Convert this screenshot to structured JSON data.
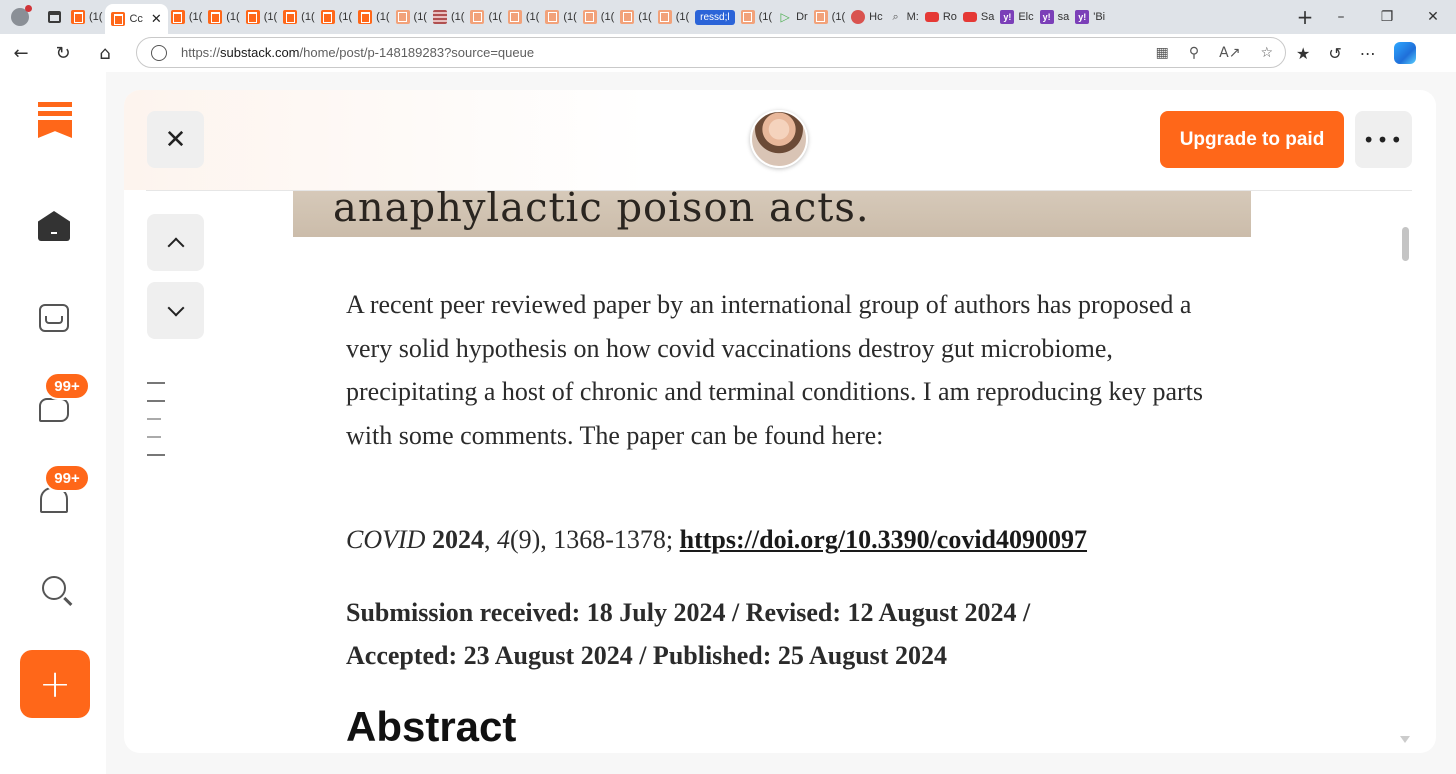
{
  "browser": {
    "tabs": [
      {
        "favicon": "substack",
        "label": "(1("
      },
      {
        "favicon": "substack",
        "label": "Cc",
        "active": true
      },
      {
        "favicon": "substack",
        "label": "(1("
      },
      {
        "favicon": "substack",
        "label": "(1("
      },
      {
        "favicon": "substack",
        "label": "(1("
      },
      {
        "favicon": "substack",
        "label": "(1("
      },
      {
        "favicon": "substack",
        "label": "(1("
      },
      {
        "favicon": "substack",
        "label": "(1("
      },
      {
        "favicon": "substack-faded",
        "label": "(1("
      },
      {
        "favicon": "stripes",
        "label": "(1("
      },
      {
        "favicon": "substack-faded",
        "label": "(1("
      },
      {
        "favicon": "substack-faded",
        "label": "(1("
      },
      {
        "favicon": "substack-faded",
        "label": "(1("
      },
      {
        "favicon": "substack-faded",
        "label": "(1("
      },
      {
        "favicon": "substack-faded",
        "label": "(1("
      },
      {
        "favicon": "substack-faded",
        "label": "(1("
      },
      {
        "favicon": "pill",
        "label": "ressd;l"
      },
      {
        "favicon": "substack-faded",
        "label": "(1("
      },
      {
        "favicon": "play",
        "label": "Dr"
      },
      {
        "favicon": "substack-faded",
        "label": "(1("
      },
      {
        "favicon": "red",
        "label": "Hc"
      },
      {
        "favicon": "search",
        "label": "M:"
      },
      {
        "favicon": "youtube",
        "label": "Ro"
      },
      {
        "favicon": "youtube",
        "label": "Sa"
      },
      {
        "favicon": "yahoo",
        "label": "Elc"
      },
      {
        "favicon": "yahoo",
        "label": "sa"
      },
      {
        "favicon": "yahoo",
        "label": "'Bi"
      }
    ],
    "url_prefix": "https://",
    "url_host": "substack.com",
    "url_path": "/home/post/p-148189283?source=queue"
  },
  "rail": {
    "chat_badge": "99+",
    "notifications_badge": "99+"
  },
  "header": {
    "upgrade_label": "Upgrade to paid",
    "more_label": "•••"
  },
  "article": {
    "scanned_text": "anaphylactic  poison  acts.",
    "paragraph": "A recent peer reviewed paper by an international group of authors has proposed a very solid hypothesis on how covid vaccinations destroy gut microbiome, precipitating a host of chronic and terminal conditions. I am reproducing key parts with some comments. The paper can be found here:",
    "citation": {
      "journal": "COVID",
      "year": "2024",
      "volume": "4",
      "issue": "(9)",
      "pages": ", 1368-1378; ",
      "doi": "https://doi.org/10.3390/covid4090097"
    },
    "dates": "Submission received: 18 July 2024 / Revised: 12 August 2024 / Accepted: 23 August 2024 / Published: 25 August 2024",
    "next_heading": "Abstract"
  },
  "colors": {
    "accent": "#ff6719"
  }
}
